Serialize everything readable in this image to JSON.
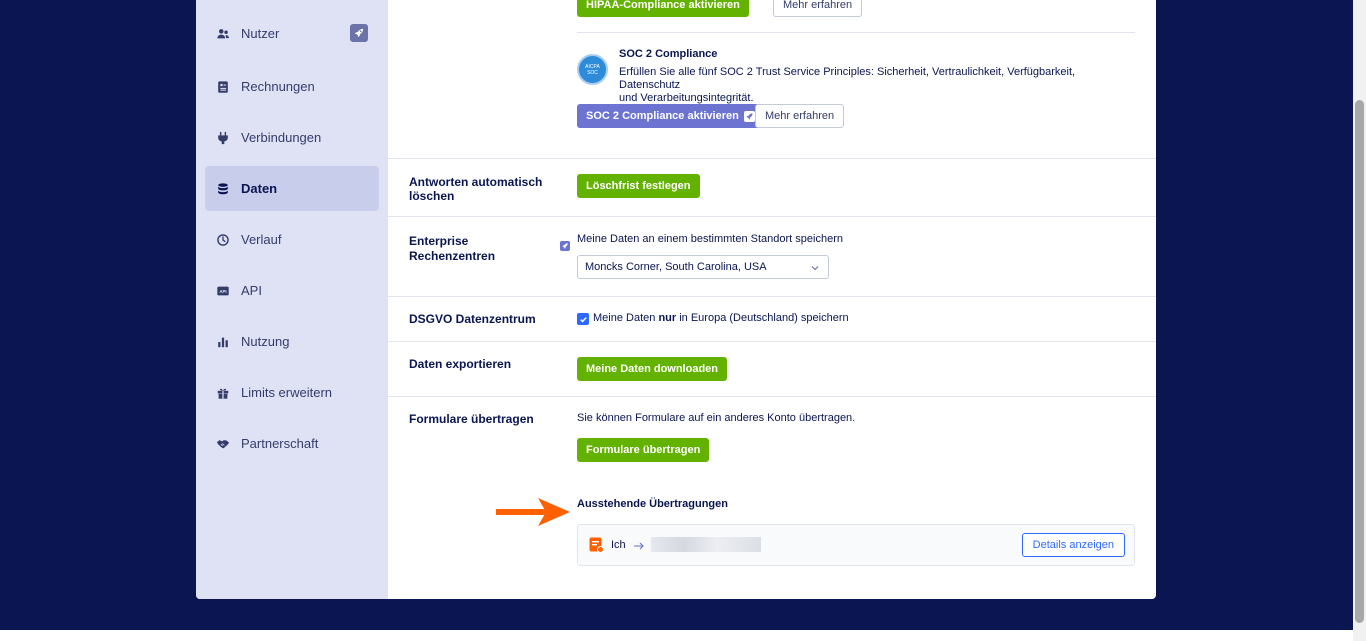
{
  "sidebar": {
    "items": [
      {
        "label": "Nutzer",
        "icon": "users-icon"
      },
      {
        "label": "Rechnungen",
        "icon": "invoice-icon"
      },
      {
        "label": "Verbindungen",
        "icon": "plug-icon"
      },
      {
        "label": "Daten",
        "icon": "database-icon",
        "active": true
      },
      {
        "label": "Verlauf",
        "icon": "history-icon"
      },
      {
        "label": "API",
        "icon": "api-icon"
      },
      {
        "label": "Nutzung",
        "icon": "bar-chart-icon"
      },
      {
        "label": "Limits erweitern",
        "icon": "gift-icon"
      },
      {
        "label": "Partnerschaft",
        "icon": "handshake-icon"
      }
    ]
  },
  "compliance": {
    "hipaa_button": "HIPAA-Compliance aktivieren",
    "hipaa_more": "Mehr erfahren",
    "soc2_title": "SOC 2 Compliance",
    "soc2_desc_line1": "Erfüllen Sie alle fünf SOC 2 Trust Service Principles: Sicherheit, Vertraulichkeit, Verfügbarkeit, Datenschutz",
    "soc2_desc_line2": "und Verarbeitungsintegrität.",
    "soc2_badge_top": "AICPA",
    "soc2_badge_bottom": "SOC",
    "soc2_button": "SOC 2 Compliance aktivieren",
    "soc2_more": "Mehr erfahren"
  },
  "auto_delete": {
    "label_line1": "Antworten automatisch",
    "label_line2": "löschen",
    "button": "Löschfrist festlegen"
  },
  "enterprise": {
    "label_line1": "Enterprise",
    "label_line2": "Rechenzentren",
    "desc": "Meine Daten an einem bestimmten Standort speichern",
    "selected_location": "Moncks Corner, South Carolina, USA"
  },
  "gdpr": {
    "label": "DSGVO Datenzentrum",
    "checkbox_pre": "Meine Daten ",
    "checkbox_bold": "nur",
    "checkbox_post": " in Europa (Deutschland) speichern",
    "checked": true
  },
  "export": {
    "label": "Daten exportieren",
    "button": "Meine Daten downloaden"
  },
  "transfer": {
    "label": "Formulare übertragen",
    "desc": "Sie können Formulare auf ein anderes Konto übertragen.",
    "button": "Formulare übertragen",
    "pending_title": "Ausstehende Übertragungen",
    "pending_from": "Ich",
    "details_button": "Details anzeigen"
  },
  "colors": {
    "background": "#0a1551",
    "green": "#64b200",
    "purple": "#6c73d1",
    "blue": "#2e69ff",
    "arrow": "#ff6100"
  }
}
